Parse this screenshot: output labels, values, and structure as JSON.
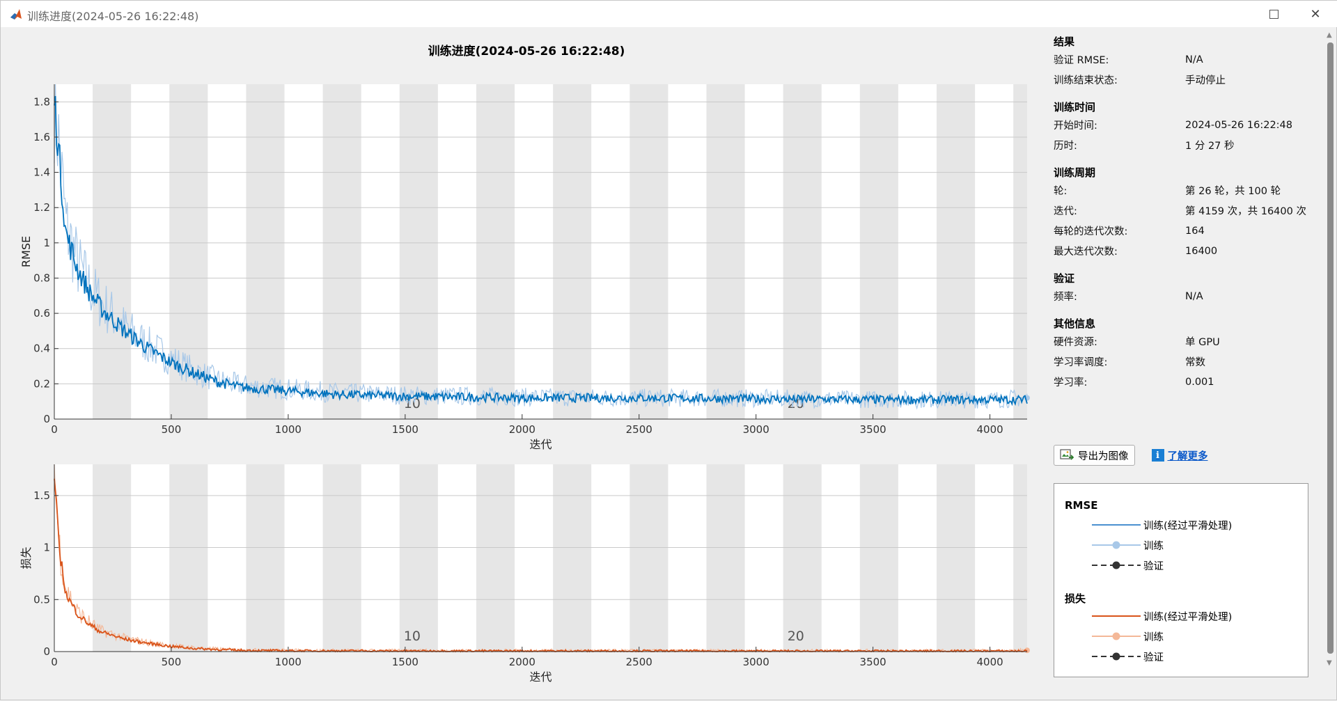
{
  "window": {
    "title": "训练进度(2024-05-26 16:22:48)",
    "maximize_icon": "maximize-icon",
    "close_glyph": "✕"
  },
  "plot_title": "训练进度(2024-05-26 16:22:48)",
  "chart_data": [
    {
      "type": "line",
      "ylabel": "RMSE",
      "xlabel": "迭代",
      "xlim": [
        0,
        4159
      ],
      "ylim": [
        0,
        1.9
      ],
      "x_ticks": [
        0,
        500,
        1000,
        1500,
        2000,
        2500,
        3000,
        3500,
        4000
      ],
      "y_ticks": [
        0,
        0.2,
        0.4,
        0.6,
        0.8,
        1,
        1.2,
        1.4,
        1.6,
        1.8
      ],
      "y_tick_labels": [
        "0",
        "0.2",
        "0.4",
        "0.6",
        "0.8",
        "1",
        "1.2",
        "1.4",
        "1.6",
        "1.8"
      ],
      "epoch_band_iterations": 164,
      "epoch_labels": [
        {
          "epoch": "10",
          "x": 1530
        },
        {
          "epoch": "20",
          "x": 3170
        }
      ],
      "grid": true,
      "series": [
        {
          "name": "训练(经过平滑处理)",
          "color": "#0072bd",
          "x": [
            0,
            20,
            50,
            100,
            150,
            200,
            300,
            400,
            500,
            600,
            700,
            800,
            1000,
            1200,
            1500,
            2000,
            2500,
            3000,
            3500,
            4000,
            4159
          ],
          "values": [
            1.82,
            1.5,
            1.05,
            0.85,
            0.72,
            0.63,
            0.5,
            0.4,
            0.32,
            0.26,
            0.21,
            0.18,
            0.16,
            0.14,
            0.13,
            0.12,
            0.12,
            0.115,
            0.11,
            0.11,
            0.11
          ]
        },
        {
          "name": "训练",
          "color": "#a8c8e8",
          "x": [
            0,
            20,
            50,
            100,
            150,
            200,
            300,
            400,
            500,
            600,
            700,
            800,
            1000,
            1200,
            1500,
            2000,
            2500,
            3000,
            3500,
            4000,
            4159
          ],
          "values": [
            1.85,
            1.55,
            1.1,
            0.88,
            0.75,
            0.66,
            0.52,
            0.42,
            0.34,
            0.27,
            0.22,
            0.19,
            0.17,
            0.15,
            0.135,
            0.125,
            0.12,
            0.118,
            0.112,
            0.11,
            0.12
          ]
        }
      ]
    },
    {
      "type": "line",
      "ylabel": "损失",
      "xlabel": "迭代",
      "xlim": [
        0,
        4159
      ],
      "ylim": [
        0,
        1.8
      ],
      "x_ticks": [
        0,
        500,
        1000,
        1500,
        2000,
        2500,
        3000,
        3500,
        4000
      ],
      "y_ticks": [
        0,
        0.5,
        1,
        1.5
      ],
      "y_tick_labels": [
        "0",
        "0.5",
        "1",
        "1.5"
      ],
      "epoch_band_iterations": 164,
      "epoch_labels": [
        {
          "epoch": "10",
          "x": 1530
        },
        {
          "epoch": "20",
          "x": 3170
        }
      ],
      "grid": true,
      "series": [
        {
          "name": "训练(经过平滑处理)",
          "color": "#d95319",
          "x": [
            0,
            20,
            50,
            100,
            150,
            200,
            300,
            400,
            500,
            600,
            700,
            800,
            1000,
            1500,
            2000,
            2500,
            3000,
            3500,
            4000,
            4159
          ],
          "values": [
            1.68,
            1.0,
            0.55,
            0.36,
            0.26,
            0.19,
            0.12,
            0.08,
            0.05,
            0.03,
            0.02,
            0.012,
            0.008,
            0.006,
            0.006,
            0.006,
            0.005,
            0.005,
            0.005,
            0.005
          ]
        },
        {
          "name": "训练",
          "color": "#f4b898",
          "x": [
            0,
            20,
            50,
            100,
            150,
            200,
            300,
            400,
            500,
            600,
            700,
            800,
            1000,
            1500,
            2000,
            2500,
            3000,
            3500,
            4000,
            4159
          ],
          "values": [
            1.72,
            1.05,
            0.6,
            0.38,
            0.28,
            0.2,
            0.13,
            0.085,
            0.055,
            0.035,
            0.022,
            0.014,
            0.009,
            0.007,
            0.007,
            0.006,
            0.006,
            0.006,
            0.006,
            0.012
          ]
        }
      ]
    }
  ],
  "info": {
    "results": {
      "title": "结果",
      "rows": [
        {
          "k": "验证 RMSE:",
          "v": "N/A"
        },
        {
          "k": "训练结束状态:",
          "v": "手动停止"
        }
      ]
    },
    "time": {
      "title": "训练时间",
      "rows": [
        {
          "k": "开始时间:",
          "v": "2024-05-26 16:22:48"
        },
        {
          "k": "历时:",
          "v": "1 分 27 秒"
        }
      ]
    },
    "cycle": {
      "title": "训练周期",
      "rows": [
        {
          "k": "轮:",
          "v": "第 26 轮，共 100 轮"
        },
        {
          "k": "迭代:",
          "v": "第 4159 次，共 16400 次"
        },
        {
          "k": "每轮的迭代次数:",
          "v": "164"
        },
        {
          "k": "最大迭代次数:",
          "v": "16400"
        }
      ]
    },
    "validation": {
      "title": "验证",
      "rows": [
        {
          "k": "频率:",
          "v": "N/A"
        }
      ]
    },
    "other": {
      "title": "其他信息",
      "rows": [
        {
          "k": "硬件资源:",
          "v": "单 GPU"
        },
        {
          "k": "学习率调度:",
          "v": "常数"
        },
        {
          "k": "学习率:",
          "v": "0.001"
        }
      ]
    }
  },
  "buttons": {
    "export": "导出为图像",
    "learn_more": "了解更多",
    "info_glyph": "i"
  },
  "legend": {
    "rmse_title": "RMSE",
    "loss_title": "损失",
    "rmse_items": [
      "训练(经过平滑处理)",
      "训练",
      "验证"
    ],
    "loss_items": [
      "训练(经过平滑处理)",
      "训练",
      "验证"
    ]
  }
}
